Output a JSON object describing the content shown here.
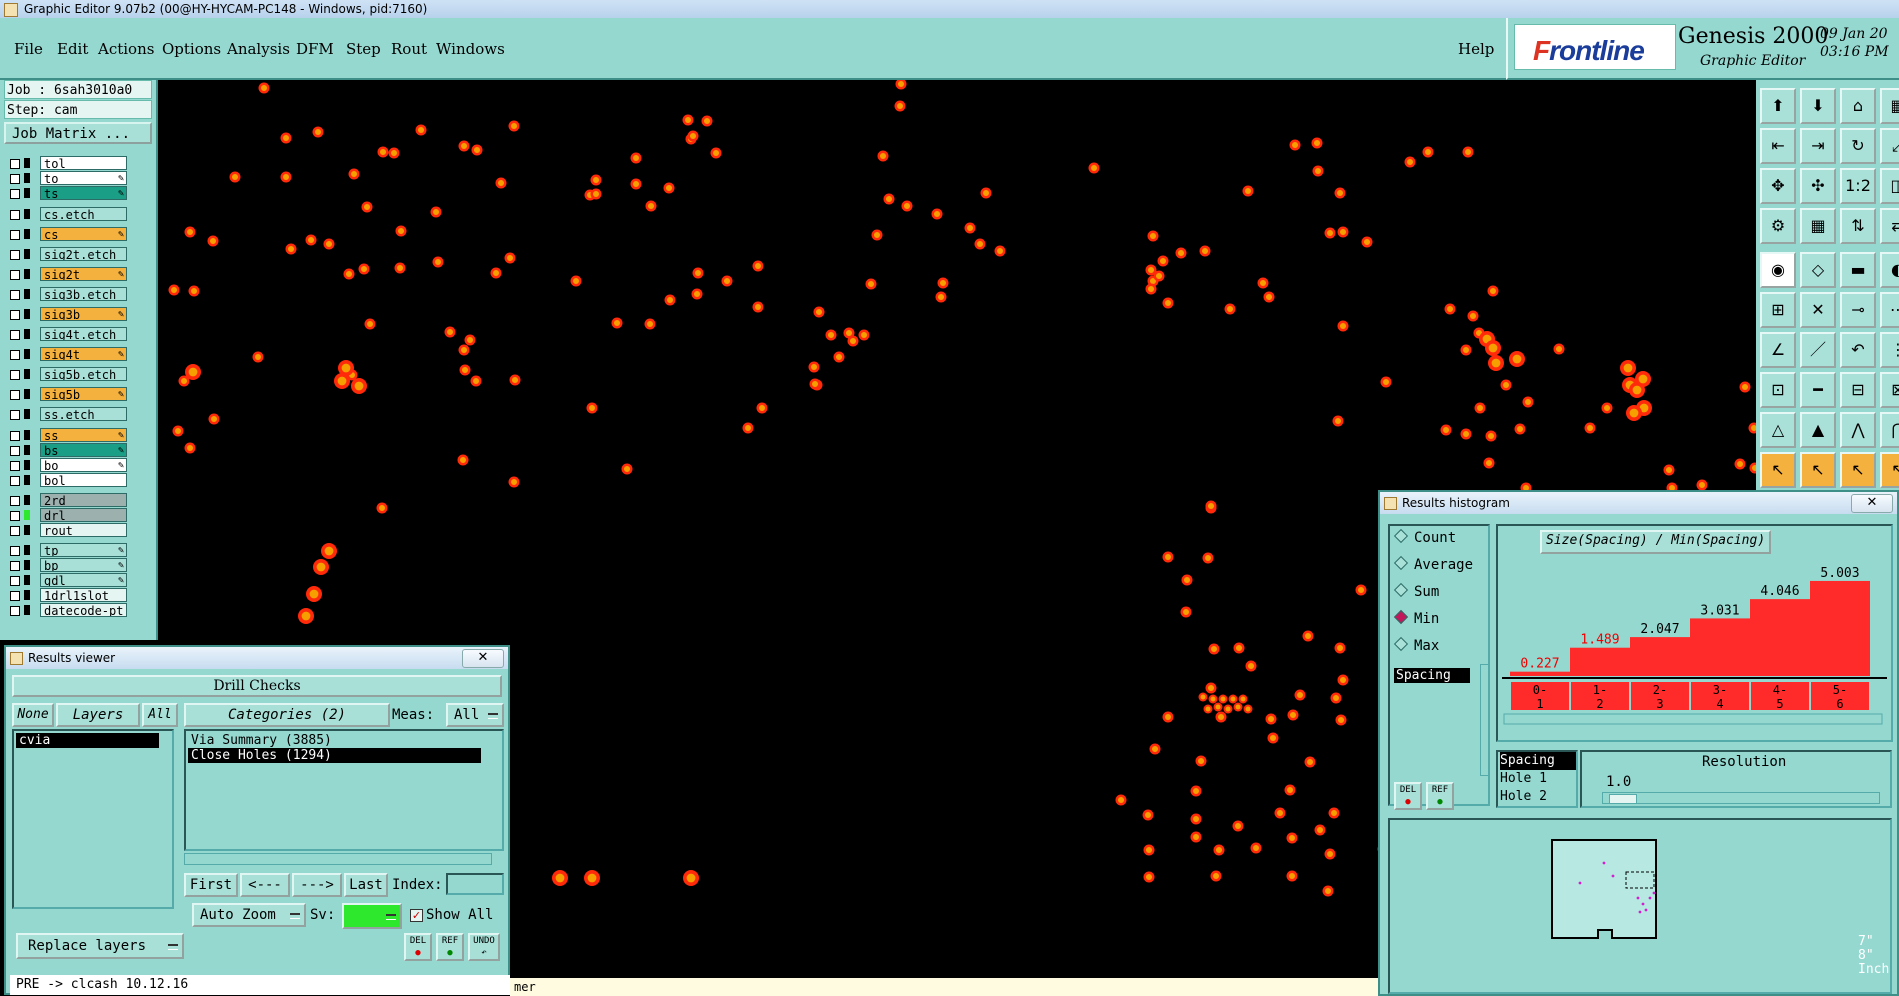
{
  "window_title": "Graphic Editor 9.07b2 (00@HY-HYCAM-PC148 - Windows, pid:7160)",
  "menu": [
    "File",
    "Edit",
    "Actions",
    "Options",
    "Analysis",
    "DFM",
    "Step",
    "Rout",
    "Windows"
  ],
  "help_label": "Help",
  "brand": {
    "logo_text_1": "F",
    "logo_text_2": "rontline",
    "product": "Genesis 2000",
    "subtitle": "Graphic Editor",
    "date": "09 Jan 20",
    "time": "03:16 PM"
  },
  "job": {
    "job_label": "Job : 6sah3010a0",
    "step_label": "Step: cam",
    "matrix_button": "Job Matrix ..."
  },
  "layers": [
    {
      "name": "tol",
      "color": "#ffffff",
      "edit": ""
    },
    {
      "name": "to",
      "color": "#ffffff",
      "edit": "✎"
    },
    {
      "name": "ts",
      "color": "#1a9e85",
      "edit": "✎"
    },
    {
      "name": "cs.etch",
      "color": "#a8e0d8",
      "edit": ""
    },
    {
      "name": "cs",
      "color": "#f5b13e",
      "edit": "✎"
    },
    {
      "name": "sig2t.etch",
      "color": "#a8e0d8",
      "edit": ""
    },
    {
      "name": "sig2t",
      "color": "#f5b13e",
      "edit": "✎"
    },
    {
      "name": "sig3b.etch",
      "color": "#a8e0d8",
      "edit": ""
    },
    {
      "name": "sig3b",
      "color": "#f5b13e",
      "edit": "✎"
    },
    {
      "name": "sig4t.etch",
      "color": "#a8e0d8",
      "edit": ""
    },
    {
      "name": "sig4t",
      "color": "#f5b13e",
      "edit": "✎"
    },
    {
      "name": "sig5b.etch",
      "color": "#a8e0d8",
      "edit": ""
    },
    {
      "name": "sig5b",
      "color": "#f5b13e",
      "edit": "✎"
    },
    {
      "name": "ss.etch",
      "color": "#a8e0d8",
      "edit": ""
    },
    {
      "name": "ss",
      "color": "#f5b13e",
      "edit": "✎"
    },
    {
      "name": "bs",
      "color": "#1a9e85",
      "edit": "✎"
    },
    {
      "name": "bo",
      "color": "#ffffff",
      "edit": "✎"
    },
    {
      "name": "bol",
      "color": "#ffffff",
      "edit": ""
    },
    {
      "name": "2rd",
      "color": "#9cb0ae",
      "edit": ""
    },
    {
      "name": "drl",
      "color": "#9cb0ae",
      "edit": ""
    },
    {
      "name": "rout",
      "color": "#e5f5f2",
      "edit": ""
    },
    {
      "name": "tp",
      "color": "#a8e0d8",
      "edit": "✎"
    },
    {
      "name": "bp",
      "color": "#a8e0d8",
      "edit": "✎"
    },
    {
      "name": "gdl",
      "color": "#a8e0d8",
      "edit": "✎"
    },
    {
      "name": "1drl1slot",
      "color": "#e5f5f2",
      "edit": ""
    },
    {
      "name": "datecode-pt",
      "color": "#e5f5f2",
      "edit": ""
    }
  ],
  "results_viewer": {
    "title": "Results viewer",
    "close": "✕",
    "header": "Drill Checks",
    "none_btn": "None",
    "layers_btn": "Layers",
    "all_btn": "All",
    "categories_btn": "Categories (2)",
    "meas_label": "Meas:",
    "meas_value": "All",
    "layer_items": [
      "cvia"
    ],
    "category_items": [
      "Via Summary (3885)",
      "Close Holes (1294)"
    ],
    "first_btn": "First",
    "prev_btn": "<---",
    "next_btn": "--->",
    "last_btn": "Last",
    "index_label": "Index:",
    "auto_zoom": "Auto Zoom",
    "sv_label": "Sv:",
    "show_all": "Show All",
    "replace_layers": "Replace layers",
    "del_btn": "DEL",
    "ref_btn": "REF",
    "undo_btn": "UNDO"
  },
  "histogram": {
    "title": "Results histogram",
    "close": "✕",
    "modes": [
      "Count",
      "Average",
      "Sum",
      "Min",
      "Max"
    ],
    "selected_mode": "Min",
    "spacing_item": "Spacing",
    "chart_title": "Size(Spacing) / Min(Spacing)",
    "fields": [
      "Spacing",
      "Hole 1",
      "Hole 2"
    ],
    "resolution_label": "Resolution",
    "resolution_value": "1.0",
    "del_btn": "DEL",
    "ref_btn": "REF"
  },
  "chart_data": {
    "type": "bar",
    "title": "Size(Spacing) / Min(Spacing)",
    "categories": [
      "0-1",
      "1-2",
      "2-3",
      "3-4",
      "4-5",
      "5-6"
    ],
    "values": [
      0.227,
      1.489,
      2.047,
      3.031,
      4.046,
      5.003
    ],
    "bar_color": "#ff2a2a",
    "ylim": [
      0,
      6
    ]
  },
  "status": {
    "command_line": "PRE -> clcash  10.12.16",
    "bottom_hint": "mer",
    "coords_1": "7\"",
    "coords_2": "8\"",
    "unit": "Inch"
  },
  "colors": {
    "panel": "#94d8d0",
    "pad_outer": "#ff2a0a",
    "pad_inner": "#f5a000",
    "background": "#000000"
  }
}
